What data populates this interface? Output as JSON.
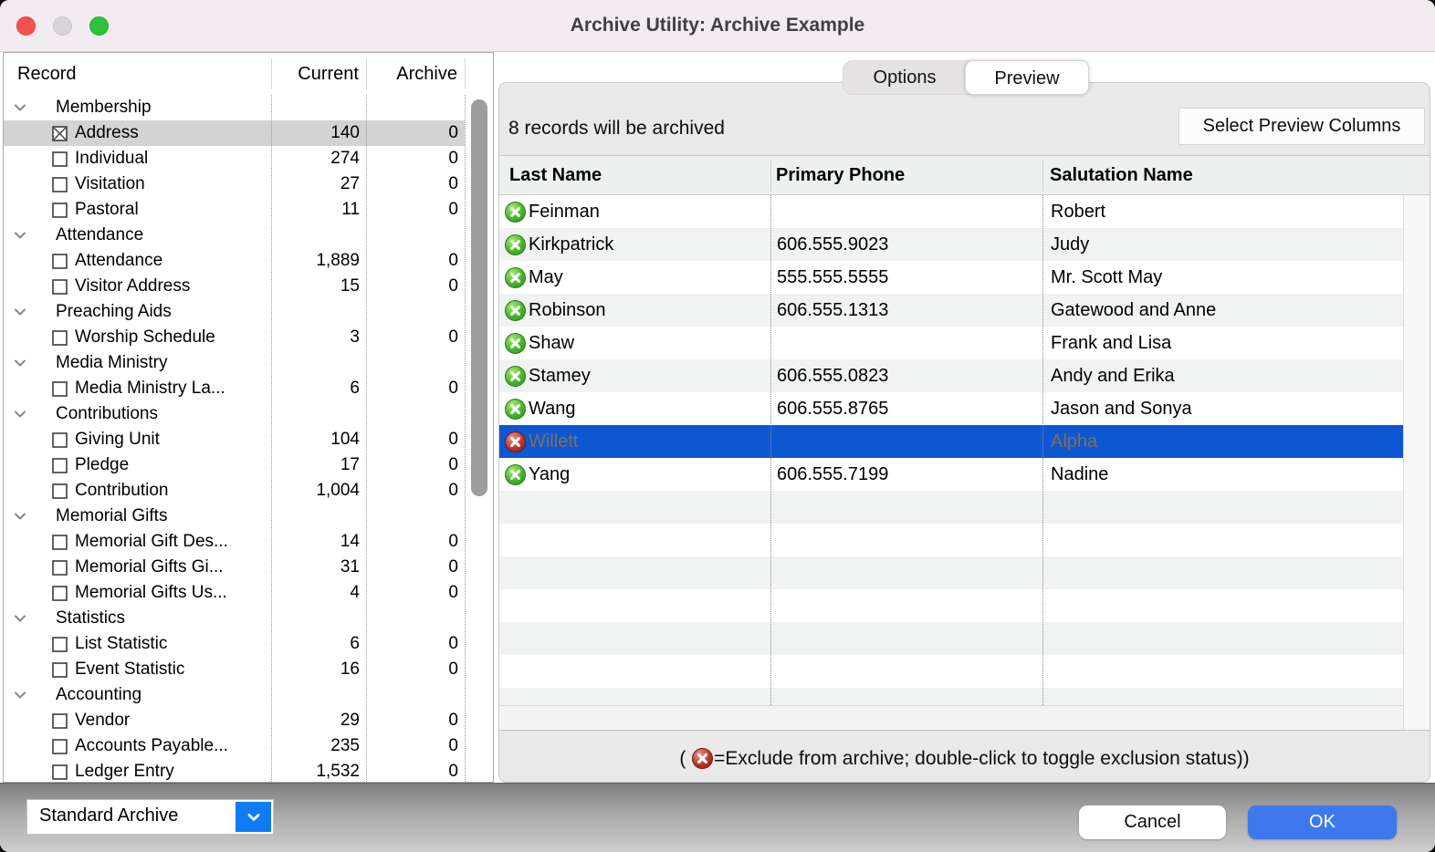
{
  "window": {
    "title": "Archive Utility: Archive Example"
  },
  "colors": {
    "titlebar_bg": "#f2ecf0",
    "close_red": "#f4534f",
    "zoom_green": "#2ec23a",
    "selection_blue": "#0d57d2",
    "selection_text": "#7f7058",
    "tree_selection_gray": "#d4d3d3",
    "include_green": "#46b52b",
    "exclude_red": "#b53028",
    "accent_blue": "#0e7bf7",
    "ok_blue": "#3d78ec"
  },
  "left_panel": {
    "columns": [
      "Record",
      "Current",
      "Archive"
    ],
    "rows": [
      {
        "type": "group",
        "label": "Membership"
      },
      {
        "type": "item",
        "label": "Address",
        "current": "140",
        "archive": "0",
        "checked": true,
        "selected": true
      },
      {
        "type": "item",
        "label": "Individual",
        "current": "274",
        "archive": "0",
        "checked": false
      },
      {
        "type": "item",
        "label": "Visitation",
        "current": "27",
        "archive": "0",
        "checked": false
      },
      {
        "type": "item",
        "label": "Pastoral",
        "current": "11",
        "archive": "0",
        "checked": false
      },
      {
        "type": "group",
        "label": "Attendance"
      },
      {
        "type": "item",
        "label": "Attendance",
        "current": "1,889",
        "archive": "0",
        "checked": false
      },
      {
        "type": "item",
        "label": "Visitor Address",
        "current": "15",
        "archive": "0",
        "checked": false
      },
      {
        "type": "group",
        "label": "Preaching Aids"
      },
      {
        "type": "item",
        "label": "Worship Schedule",
        "current": "3",
        "archive": "0",
        "checked": false
      },
      {
        "type": "group",
        "label": "Media Ministry"
      },
      {
        "type": "item",
        "label": "Media Ministry La...",
        "current": "6",
        "archive": "0",
        "checked": false
      },
      {
        "type": "group",
        "label": "Contributions"
      },
      {
        "type": "item",
        "label": "Giving Unit",
        "current": "104",
        "archive": "0",
        "checked": false
      },
      {
        "type": "item",
        "label": "Pledge",
        "current": "17",
        "archive": "0",
        "checked": false
      },
      {
        "type": "item",
        "label": "Contribution",
        "current": "1,004",
        "archive": "0",
        "checked": false
      },
      {
        "type": "group",
        "label": "Memorial Gifts"
      },
      {
        "type": "item",
        "label": "Memorial Gift Des...",
        "current": "14",
        "archive": "0",
        "checked": false
      },
      {
        "type": "item",
        "label": "Memorial Gifts Gi...",
        "current": "31",
        "archive": "0",
        "checked": false
      },
      {
        "type": "item",
        "label": "Memorial Gifts Us...",
        "current": "4",
        "archive": "0",
        "checked": false
      },
      {
        "type": "group",
        "label": "Statistics"
      },
      {
        "type": "item",
        "label": "List Statistic",
        "current": "6",
        "archive": "0",
        "checked": false
      },
      {
        "type": "item",
        "label": "Event Statistic",
        "current": "16",
        "archive": "0",
        "checked": false
      },
      {
        "type": "group",
        "label": "Accounting"
      },
      {
        "type": "item",
        "label": "Vendor",
        "current": "29",
        "archive": "0",
        "checked": false
      },
      {
        "type": "item",
        "label": "Accounts Payable...",
        "current": "235",
        "archive": "0",
        "checked": false
      },
      {
        "type": "item",
        "label": "Ledger Entry",
        "current": "1,532",
        "archive": "0",
        "checked": false
      }
    ]
  },
  "tabs": [
    {
      "label": "Options",
      "selected": false
    },
    {
      "label": "Preview",
      "selected": true
    }
  ],
  "preview": {
    "summary": "8 records will be archived",
    "select_columns_label": "Select Preview Columns",
    "table": {
      "columns": [
        "Last Name",
        "Primary Phone",
        "Salutation Name"
      ],
      "rows": [
        {
          "last_name": "Feinman",
          "phone": "",
          "salutation": "Robert",
          "excluded": false,
          "selected": false
        },
        {
          "last_name": "Kirkpatrick",
          "phone": "606.555.9023",
          "salutation": "Judy",
          "excluded": false,
          "selected": false
        },
        {
          "last_name": "May",
          "phone": "555.555.5555",
          "salutation": "Mr. Scott May",
          "excluded": false,
          "selected": false
        },
        {
          "last_name": "Robinson",
          "phone": "606.555.1313",
          "salutation": "Gatewood and Anne",
          "excluded": false,
          "selected": false
        },
        {
          "last_name": "Shaw",
          "phone": "",
          "salutation": "Frank and Lisa",
          "excluded": false,
          "selected": false
        },
        {
          "last_name": "Stamey",
          "phone": "606.555.0823",
          "salutation": "Andy and Erika",
          "excluded": false,
          "selected": false
        },
        {
          "last_name": "Wang",
          "phone": "606.555.8765",
          "salutation": "Jason and Sonya",
          "excluded": false,
          "selected": false
        },
        {
          "last_name": "Willett",
          "phone": "",
          "salutation": "Alpha",
          "excluded": true,
          "selected": true
        },
        {
          "last_name": "Yang",
          "phone": "606.555.7199",
          "salutation": "Nadine",
          "excluded": false,
          "selected": false
        }
      ]
    },
    "legend": {
      "open": "( ",
      "text": "=Exclude from archive; double-click to toggle exclusion status))"
    }
  },
  "footer": {
    "archive_type_value": "Standard Archive",
    "cancel_label": "Cancel",
    "ok_label": "OK"
  }
}
